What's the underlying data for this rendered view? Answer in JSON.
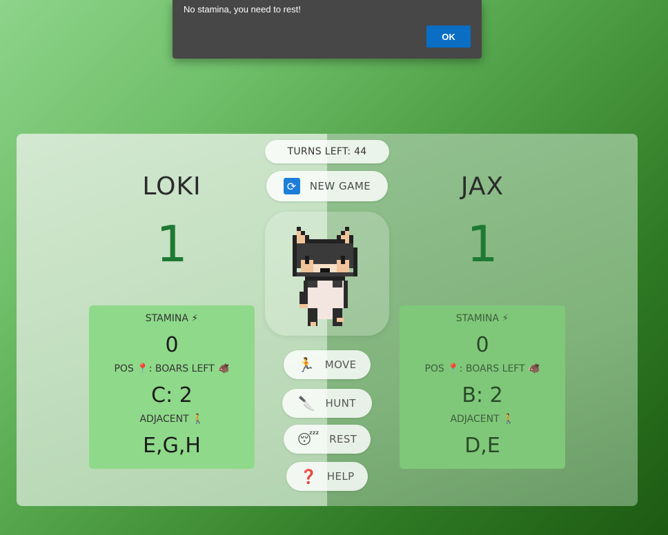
{
  "dialog": {
    "message": "No stamina, you need to rest!",
    "ok_label": "OK"
  },
  "header": {
    "turns_left": "TURNS LEFT: 44",
    "new_game_label": "NEW GAME"
  },
  "players": [
    {
      "name": "LOKI",
      "score": "1",
      "stamina_label": "STAMINA ⚡",
      "stamina_value": "0",
      "pos_label": "POS 📍: BOARS LEFT 🐗",
      "pos_value": "C: 2",
      "adjacent_label": "ADJACENT 🚶",
      "adjacent_value": "E,G,H"
    },
    {
      "name": "JAX",
      "score": "1",
      "stamina_label": "STAMINA ⚡",
      "stamina_value": "0",
      "pos_label": "POS 📍: BOARS LEFT 🐗",
      "pos_value": "B: 2",
      "adjacent_label": "ADJACENT 🚶",
      "adjacent_value": "D,E"
    }
  ],
  "actions": {
    "move": {
      "icon": "🏃",
      "label": "MOVE"
    },
    "hunt": {
      "icon": "🔪",
      "label": "HUNT"
    },
    "rest": {
      "icon": "😴",
      "label": "REST"
    },
    "help": {
      "icon": "❓",
      "label": "HELP"
    }
  },
  "colors": {
    "accent": "#0a6ec5",
    "score": "#1e7a32",
    "card_left": "#8fd98a",
    "card_right": "#7fc879"
  },
  "icons": {
    "new_game": "refresh-icon",
    "pet": "cat-sprite"
  }
}
